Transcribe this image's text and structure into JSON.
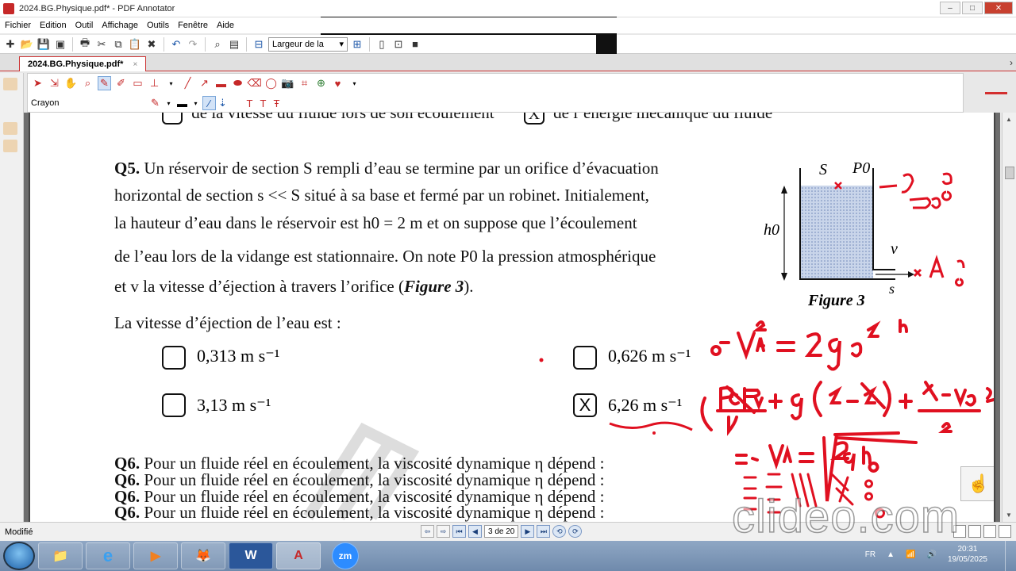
{
  "window": {
    "title": "2024.BG.Physique.pdf* - PDF Annotator",
    "controls": [
      "–",
      "□",
      "✕"
    ]
  },
  "menu": [
    "Fichier",
    "Edition",
    "Outil",
    "Affichage",
    "Outils",
    "Fenêtre",
    "Aide"
  ],
  "toolbar": {
    "zoom_label": "Largeur de la"
  },
  "tab": {
    "label": "2024.BG.Physique.pdf*",
    "close": "×"
  },
  "pen_toolbar": {
    "tool_name": "Crayon"
  },
  "document": {
    "cut_line": {
      "left": "de la vitesse du fluide lors de son écoulement",
      "right": "de l’énergie mécanique du fluide"
    },
    "q5": {
      "number": "Q5.",
      "line1": "Un réservoir de section S rempli d’eau se termine par un orifice d’évacuation",
      "line2": "horizontal de section  s << S  situé à sa base et fermé par un robinet. Initialement,",
      "line3": "la hauteur d’eau dans le réservoir est  h0 = 2 m  et on suppose que l’écoulement",
      "line4": "de l’eau lors de la vidange est stationnaire. On note  P0  la pression atmosphérique",
      "line5a": "et  v  la vitesse d’éjection à travers l’orifice (",
      "line5b": "Figure 3",
      "line5c": ").",
      "prompt": "La vitesse d’éjection de l’eau est :",
      "answers": [
        {
          "text": "0,313 m s⁻¹",
          "checked": ""
        },
        {
          "text": "0,626 m s⁻¹",
          "checked": ""
        },
        {
          "text": "3,13 m s⁻¹",
          "checked": ""
        },
        {
          "text": "6,26 m s⁻¹",
          "checked": "X"
        }
      ]
    },
    "figure": {
      "label_S": "S",
      "label_P0": "P0",
      "label_h0": "h0",
      "label_v": "v",
      "label_s": "s",
      "caption": "Figure 3"
    },
    "q6": {
      "number": "Q6.",
      "text": "Pour un fluide réel en écoulement, la viscosité dynamique η dépend :"
    }
  },
  "status": {
    "left": "Modifié",
    "page": "3 de 20",
    "watermark": "clideo.com"
  },
  "taskbar": {
    "apps": [
      "📁",
      "e",
      "▶",
      "🦊",
      "W",
      "A",
      "zm"
    ],
    "lang": "FR",
    "time": "20:31",
    "date": "19/05/2025"
  }
}
